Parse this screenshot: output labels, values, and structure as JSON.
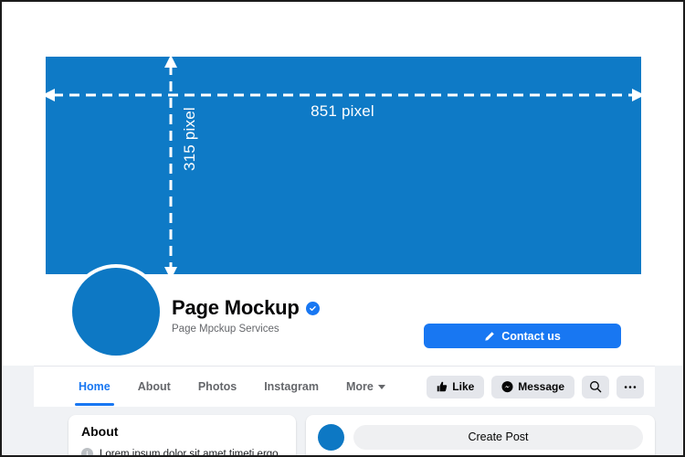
{
  "cover": {
    "width_label": "851 pixel",
    "height_label": "315 pixel",
    "color": "#0e7ac6"
  },
  "profile": {
    "name": "Page Mockup",
    "tagline": "Page Mpckup Services",
    "verified": true,
    "avatar_color": "#0d78c4",
    "contact_button": {
      "label": "Contact us",
      "icon": "pencil-icon",
      "color": "#1877F2"
    }
  },
  "nav": {
    "tabs": [
      {
        "label": "Home",
        "active": true
      },
      {
        "label": "About",
        "active": false
      },
      {
        "label": "Photos",
        "active": false
      },
      {
        "label": "Instagram",
        "active": false
      },
      {
        "label": "More",
        "active": false,
        "caret": true
      }
    ],
    "actions": [
      {
        "label": "Like",
        "icon": "thumbs-up-icon"
      },
      {
        "label": "Message",
        "icon": "messenger-icon"
      },
      {
        "label": "",
        "icon": "search-icon"
      },
      {
        "label": "",
        "icon": "ellipsis-icon"
      }
    ]
  },
  "about_card": {
    "title": "About",
    "info_icon": "info-icon",
    "text": "Lorem ipsum dolor sit amet timeti ergo"
  },
  "composer": {
    "placeholder": "Create Post",
    "avatar_color": "#0d78c4"
  }
}
